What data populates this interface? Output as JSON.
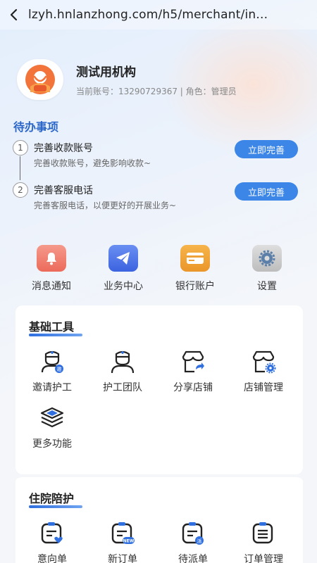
{
  "browser": {
    "url": "lzyh.hnlanzhong.com/h5/merchant/in..."
  },
  "profile": {
    "org_name": "测试用机构",
    "account_line": "当前账号：13290729367 | 角色：管理员"
  },
  "todo": {
    "title": "待办事项",
    "items": [
      {
        "num": "1",
        "title": "完善收款账号",
        "desc": "完善收款账号，避免影响收款~",
        "button": "立即完善"
      },
      {
        "num": "2",
        "title": "完善客服电话",
        "desc": "完善客服电话，以便更好的开展业务~",
        "button": "立即完善"
      }
    ]
  },
  "quick": [
    {
      "label": "消息通知",
      "icon": "bell-icon",
      "color": "#f07a6a"
    },
    {
      "label": "业务中心",
      "icon": "paper-plane-icon",
      "color": "#4a72e8"
    },
    {
      "label": "银行账户",
      "icon": "bank-card-icon",
      "color": "#f1a33a"
    },
    {
      "label": "设置",
      "icon": "gear-icon",
      "color": "#c9c9c9"
    }
  ],
  "basic_tools": {
    "title": "基础工具",
    "items": [
      {
        "label": "邀请护工",
        "icon": "invite-nurse-icon"
      },
      {
        "label": "护工团队",
        "icon": "nurse-team-icon"
      },
      {
        "label": "分享店铺",
        "icon": "share-store-icon"
      },
      {
        "label": "店铺管理",
        "icon": "store-manage-icon"
      },
      {
        "label": "更多功能",
        "icon": "layers-icon"
      }
    ],
    "badge_text": "邀"
  },
  "hospital": {
    "title": "住院陪护",
    "items": [
      {
        "label": "意向单",
        "icon": "intent-order-icon"
      },
      {
        "label": "新订单",
        "icon": "new-order-icon",
        "badge": "NEW"
      },
      {
        "label": "待派单",
        "icon": "pending-dispatch-icon",
        "badge": "派"
      },
      {
        "label": "订单管理",
        "icon": "order-manage-icon"
      }
    ]
  },
  "colors": {
    "accent": "#3b86e6",
    "title_blue": "#2a66c7"
  }
}
